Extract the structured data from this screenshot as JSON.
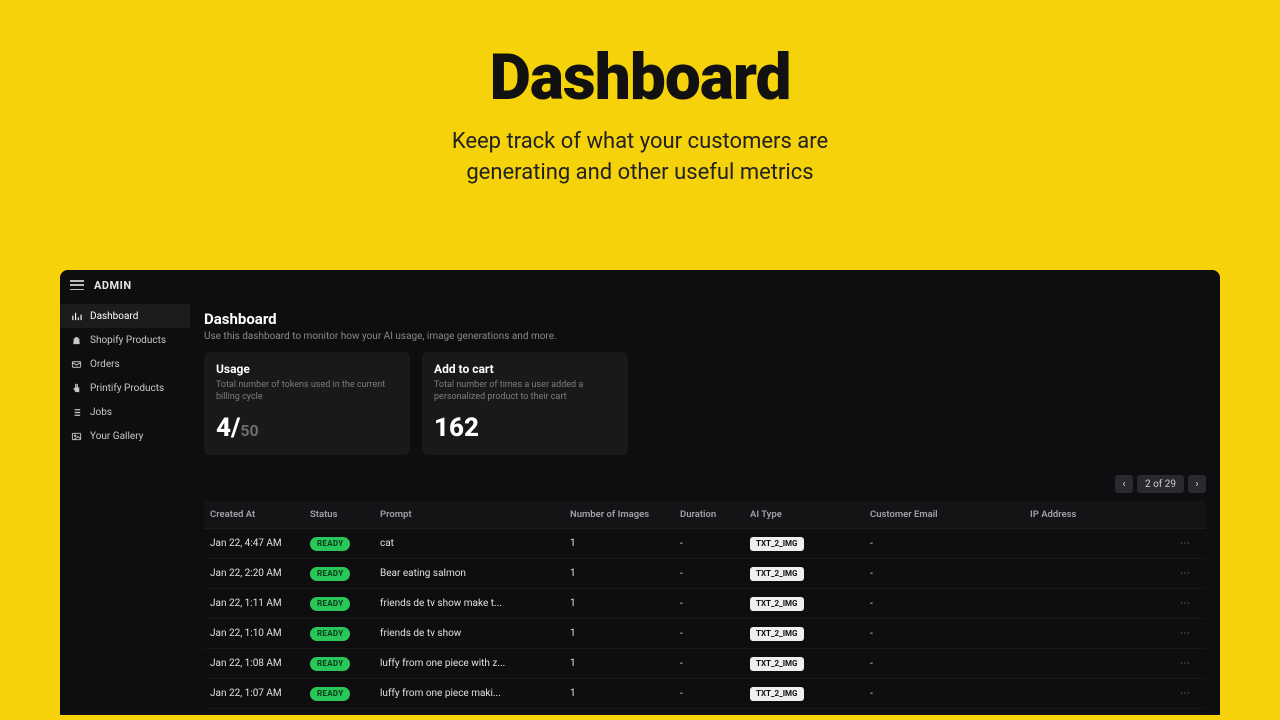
{
  "hero": {
    "title": "Dashboard",
    "subtitle_l1": "Keep track of what your customers are",
    "subtitle_l2": "generating and other useful metrics"
  },
  "topbar": {
    "brand": "ADMIN"
  },
  "sidebar": {
    "items": [
      {
        "label": "Dashboard",
        "icon": "bar-chart-icon"
      },
      {
        "label": "Shopify Products",
        "icon": "bag-icon"
      },
      {
        "label": "Orders",
        "icon": "mail-icon"
      },
      {
        "label": "Printify Products",
        "icon": "hand-icon"
      },
      {
        "label": "Jobs",
        "icon": "list-icon"
      },
      {
        "label": "Your Gallery",
        "icon": "image-icon"
      }
    ]
  },
  "main": {
    "title": "Dashboard",
    "subtitle": "Use this dashboard to monitor how your AI usage, image generations and more."
  },
  "cards": {
    "usage": {
      "title": "Usage",
      "desc": "Total number of tokens used in the current billing cycle",
      "value": "4/",
      "denom": "50"
    },
    "cart": {
      "title": "Add to cart",
      "desc": "Total number of times a user added a personalized product to their cart",
      "value": "162"
    }
  },
  "pager": {
    "text": "2 of 29",
    "prev": "‹",
    "next": "›"
  },
  "table": {
    "headers": [
      "Created At",
      "Status",
      "Prompt",
      "Number of Images",
      "Duration",
      "AI Type",
      "Customer Email",
      "IP Address",
      ""
    ],
    "status_label": "READY",
    "type_label": "TXT_2_IMG",
    "rows": [
      {
        "created": "Jan 22, 4:47 AM",
        "prompt": "cat",
        "images": "1",
        "duration": "-",
        "email": "-",
        "ip": ""
      },
      {
        "created": "Jan 22, 2:20 AM",
        "prompt": "Bear eating salmon",
        "images": "1",
        "duration": "-",
        "email": "-",
        "ip": ""
      },
      {
        "created": "Jan 22, 1:11 AM",
        "prompt": "friends de tv show make t...",
        "images": "1",
        "duration": "-",
        "email": "-",
        "ip": ""
      },
      {
        "created": "Jan 22, 1:10 AM",
        "prompt": "friends de tv show",
        "images": "1",
        "duration": "-",
        "email": "-",
        "ip": ""
      },
      {
        "created": "Jan 22, 1:08 AM",
        "prompt": "luffy from one piece with z...",
        "images": "1",
        "duration": "-",
        "email": "-",
        "ip": ""
      },
      {
        "created": "Jan 22, 1:07 AM",
        "prompt": "luffy from one piece maki...",
        "images": "1",
        "duration": "-",
        "email": "-",
        "ip": ""
      }
    ]
  }
}
